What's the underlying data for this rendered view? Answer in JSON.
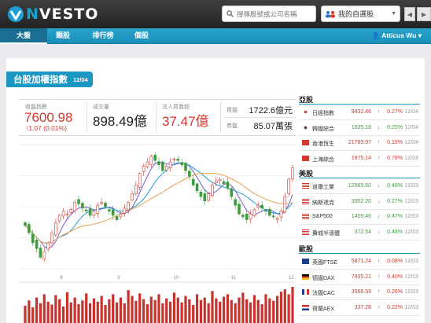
{
  "app": {
    "logo_text": "NVESTO",
    "search_placeholder": "搜尋股號或公司名稱",
    "watchlist_label": "我的自選股",
    "user": "Atticus Wu"
  },
  "nav": {
    "tabs": [
      "大盤",
      "類股",
      "排行榜",
      "個股"
    ],
    "active": 0
  },
  "index_panel": {
    "title": "台股加權指數",
    "date": "12/04",
    "close_label": "收盤指數",
    "close": "7600.98",
    "change": "↑1.07 (0.01%)",
    "volume_label": "成交量",
    "volume": "898.49億",
    "foreign_label": "法人買賣超",
    "foreign": "37.47億",
    "buy_label": "買盤",
    "buy_value": "1722.6億元",
    "sell_label": "券盤",
    "sell_value": "85.07萬張"
  },
  "chart_data": {
    "type": "candlestick",
    "x_ticks": [
      "8",
      "9",
      "10",
      "11",
      "12"
    ],
    "series_colors": {
      "up": "#d4382e",
      "down": "#3d9d3d",
      "ma_short": "#7a5ad1",
      "ma_mid": "#1e9ed6",
      "ma_long": "#e8a24a",
      "volume": "#c8322c"
    },
    "closes": [
      7420,
      7395,
      7360,
      7340,
      7310,
      7330,
      7360,
      7395,
      7430,
      7455,
      7470,
      7460,
      7475,
      7500,
      7495,
      7480,
      7470,
      7455,
      7470,
      7490,
      7500,
      7485,
      7470,
      7455,
      7440,
      7460,
      7480,
      7500,
      7530,
      7560,
      7600,
      7625,
      7640,
      7660,
      7645,
      7630,
      7610,
      7625,
      7640,
      7650,
      7645,
      7630,
      7610,
      7590,
      7560,
      7540,
      7520,
      7505,
      7530,
      7560,
      7575,
      7580,
      7565,
      7550,
      7520,
      7490,
      7460,
      7450,
      7440,
      7460,
      7475,
      7490,
      7480,
      7470,
      7455,
      7450,
      7445,
      7470,
      7520,
      7580,
      7620
    ],
    "volumes": [
      42,
      55,
      38,
      62,
      48,
      70,
      52,
      45,
      68,
      58,
      40,
      75,
      50,
      62,
      46,
      55,
      72,
      48,
      60,
      52,
      66,
      44,
      58,
      70,
      50,
      62,
      48,
      80,
      66,
      54,
      72,
      58,
      46,
      64,
      56,
      70,
      48,
      60,
      52,
      74,
      62,
      50,
      66,
      58,
      44,
      70,
      56,
      62,
      48,
      78,
      60,
      52,
      64,
      70,
      56,
      48,
      62,
      74,
      58,
      50,
      68,
      56,
      46,
      70,
      60,
      54,
      66,
      76,
      82,
      70,
      88
    ]
  },
  "markets": [
    {
      "region": "亞股",
      "rows": [
        {
          "flag": "jp",
          "name": "日經指數",
          "price": "9432.46",
          "dir": "up",
          "pct": "0.27%",
          "date": "12/04"
        },
        {
          "flag": "kr",
          "name": "韓國綜合",
          "price": "1935.18",
          "dir": "down",
          "pct": "0.25%",
          "date": "12/04"
        },
        {
          "flag": "hk",
          "name": "香港恆生",
          "price": "21799.97",
          "dir": "up",
          "pct": "0.15%",
          "date": "12/04"
        },
        {
          "flag": "cn",
          "name": "上海綜合",
          "price": "1975.14",
          "dir": "up",
          "pct": "0.78%",
          "date": "12/04"
        }
      ]
    },
    {
      "region": "美股",
      "rows": [
        {
          "flag": "us",
          "name": "道瓊工業",
          "price": "12965.60",
          "dir": "down",
          "pct": "0.46%",
          "date": "12/03"
        },
        {
          "flag": "us",
          "name": "納斯達克",
          "price": "3002.20",
          "dir": "down",
          "pct": "0.27%",
          "date": "12/03"
        },
        {
          "flag": "us",
          "name": "S&P500",
          "price": "1409.46",
          "dir": "down",
          "pct": "0.47%",
          "date": "12/03"
        },
        {
          "flag": "us",
          "name": "費城半導體",
          "price": "372.54",
          "dir": "down",
          "pct": "0.48%",
          "date": "12/03"
        }
      ]
    },
    {
      "region": "歐股",
      "rows": [
        {
          "flag": "gb",
          "name": "英國FTSE",
          "price": "5871.24",
          "dir": "up",
          "pct": "0.08%",
          "date": "12/03"
        },
        {
          "flag": "de",
          "name": "德國DAX",
          "price": "7435.21",
          "dir": "up",
          "pct": "0.40%",
          "date": "12/03"
        },
        {
          "flag": "fr",
          "name": "法國CAC",
          "price": "3566.59",
          "dir": "up",
          "pct": "0.26%",
          "date": "12/03"
        },
        {
          "flag": "nl",
          "name": "荷蘭AEX",
          "price": "337.28",
          "dir": "up",
          "pct": "0.22%",
          "date": "12/03"
        }
      ]
    }
  ]
}
